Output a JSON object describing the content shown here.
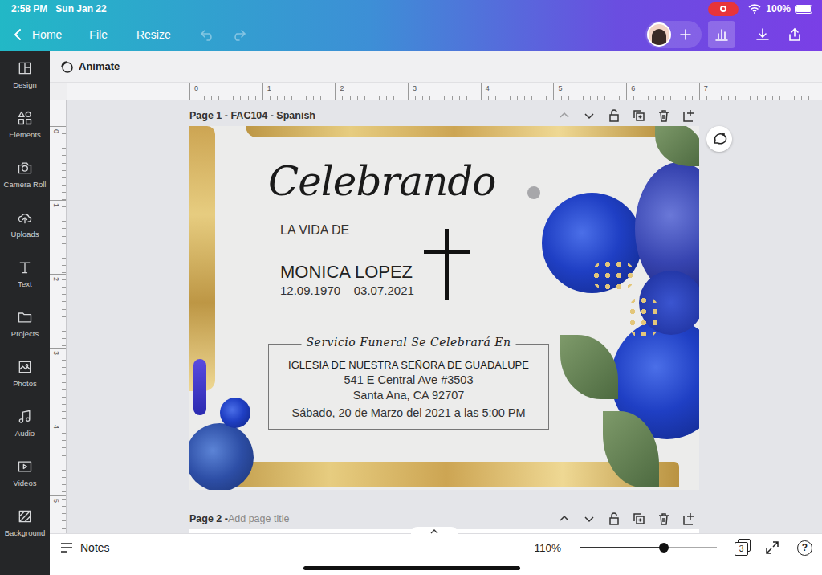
{
  "status_bar": {
    "time": "2:58 PM",
    "date": "Sun Jan 22",
    "recording": true,
    "battery": "100%",
    "battery_level": 1
  },
  "toolbar": {
    "back": "Home",
    "menus": [
      "File",
      "Resize"
    ],
    "undo_enabled": false,
    "redo_enabled": false
  },
  "animate": {
    "label": "Animate"
  },
  "sidebar": {
    "items": [
      {
        "label": "Design"
      },
      {
        "label": "Elements"
      },
      {
        "label": "Camera Roll"
      },
      {
        "label": "Uploads"
      },
      {
        "label": "Text"
      },
      {
        "label": "Projects"
      },
      {
        "label": "Photos"
      },
      {
        "label": "Audio"
      },
      {
        "label": "Videos"
      },
      {
        "label": "Background"
      }
    ]
  },
  "rulers": {
    "horizontal": [
      "0",
      "1",
      "2",
      "3",
      "4",
      "5",
      "6",
      "7"
    ],
    "vertical": [
      "0",
      "1",
      "2",
      "3",
      "4",
      "5"
    ]
  },
  "pages": [
    {
      "label": "Page 1 - FAC104 - Spanish",
      "move_up_enabled": false
    },
    {
      "label": "Page 2 -",
      "placeholder": "Add page title",
      "move_up_enabled": true
    }
  ],
  "design": {
    "heading": "Celebrando",
    "subheading": "LA VIDA DE",
    "name": "MONICA LOPEZ",
    "dates": "12.09.1970 – 03.07.2021",
    "service_label": "Servicio Funeral Se Celebrará En",
    "venue_lines": [
      "IGLESIA DE NUESTRA SEÑORA DE GUADALUPE",
      "541 E Central Ave #3503",
      "Santa Ana, CA 92707",
      "Sábado, 20 de Marzo del 2021 a las 5:00 PM"
    ]
  },
  "bottom_bar": {
    "notes": "Notes",
    "zoom": "110%",
    "zoom_level": 0.61,
    "page_count": "3",
    "help": "?"
  }
}
